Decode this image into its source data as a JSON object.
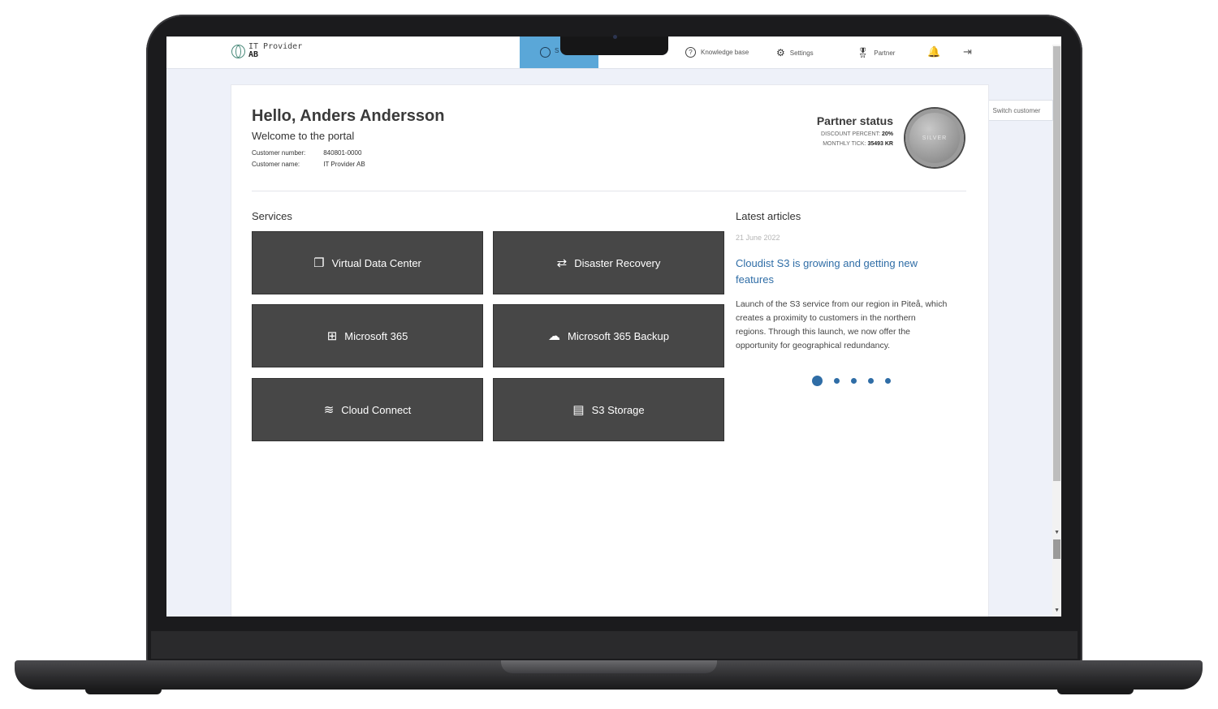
{
  "brand": {
    "line1": "IT Provider",
    "line2": "AB"
  },
  "nav": {
    "active_label": "S",
    "knowledge": "Knowledge base",
    "settings": "Settings",
    "partner": "Partner"
  },
  "header": {
    "greeting": "Hello, Anders Andersson",
    "welcome": "Welcome to the portal",
    "customer_number_label": "Customer number:",
    "customer_number": "840801-0000",
    "customer_name_label": "Customer name:",
    "customer_name": "IT Provider AB"
  },
  "partner_status": {
    "title": "Partner status",
    "discount_label": "DISCOUNT PERCENT:",
    "discount": "20%",
    "tick_label": "MONTHLY TICK:",
    "tick": "35493 KR",
    "tier": "SILVER"
  },
  "switch_customer": "Switch customer",
  "services": {
    "title": "Services",
    "items": [
      {
        "label": "Virtual Data Center",
        "icon": "copy-icon"
      },
      {
        "label": "Disaster Recovery",
        "icon": "sync-icon"
      },
      {
        "label": "Microsoft 365",
        "icon": "windows-icon"
      },
      {
        "label": "Microsoft 365 Backup",
        "icon": "cloud-icon"
      },
      {
        "label": "Cloud Connect",
        "icon": "layers-icon"
      },
      {
        "label": "S3 Storage",
        "icon": "archive-icon"
      }
    ]
  },
  "articles": {
    "title": "Latest articles",
    "date": "21 June 2022",
    "headline": "Cloudist S3 is growing and getting new features",
    "body": "Launch of the S3 service from our region in Piteå, which creates a proximity to customers in the northern regions. Through this launch, we now offer the opportunity for geographical redundancy.",
    "slide_count": 5,
    "active_slide": 1
  },
  "colors": {
    "accent": "#5aa7d8",
    "link": "#2f6da6",
    "tile": "#474747"
  }
}
